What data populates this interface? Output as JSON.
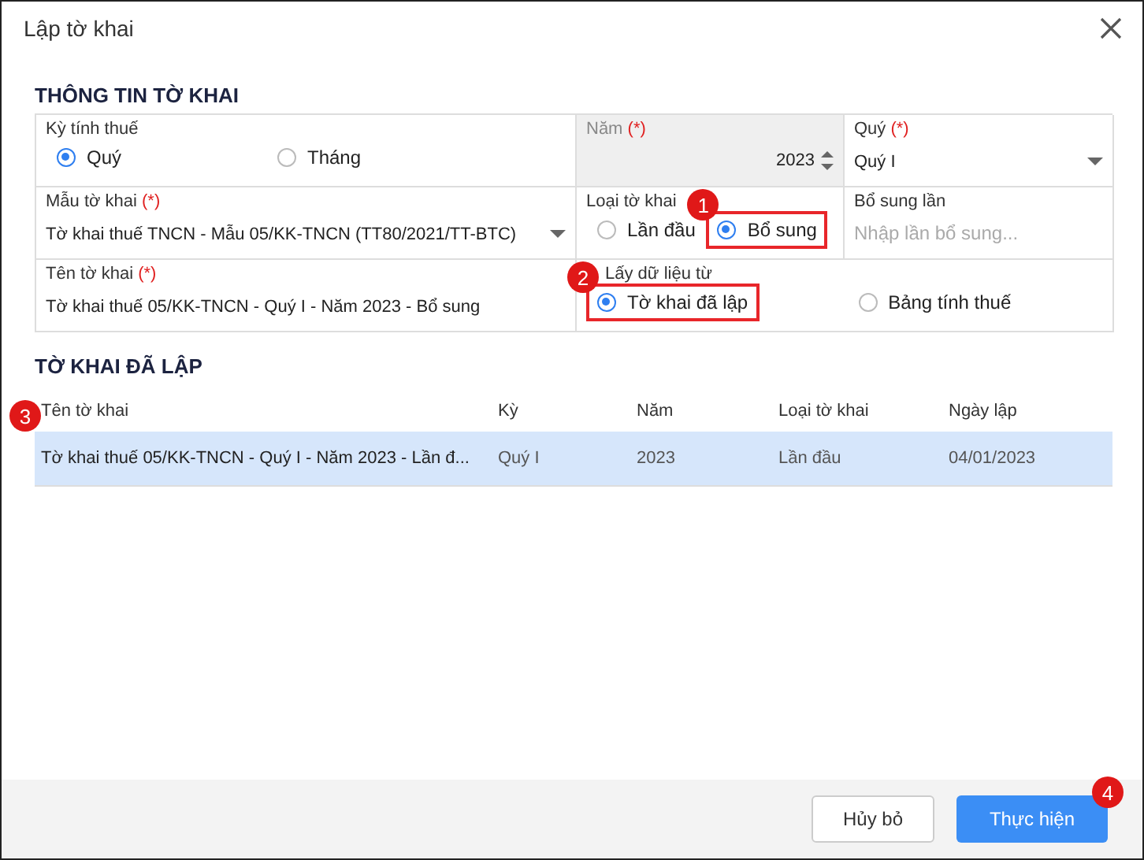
{
  "window": {
    "title": "Lập tờ khai"
  },
  "info": {
    "heading": "THÔNG TIN TỜ KHAI",
    "period": {
      "label": "Kỳ tính thuế",
      "options": [
        {
          "label": "Quý",
          "selected": true,
          "highlighted": false
        },
        {
          "label": "Tháng",
          "selected": false,
          "highlighted": false
        }
      ]
    },
    "year": {
      "label": "Năm",
      "required": "(*)",
      "value": "2023",
      "disabled": true
    },
    "quarter": {
      "label": "Quý",
      "required": "(*)",
      "value": "Quý I"
    },
    "form": {
      "label": "Mẫu tờ khai",
      "required": "(*)",
      "value": "Tờ khai thuế TNCN - Mẫu 05/KK-TNCN (TT80/2021/TT-BTC)"
    },
    "type": {
      "label": "Loại tờ khai",
      "options": [
        {
          "label": "Lần đầu",
          "selected": false,
          "highlighted": false
        },
        {
          "label": "Bổ sung",
          "selected": true,
          "highlighted": true,
          "badge": "1"
        }
      ]
    },
    "supplement": {
      "label": "Bổ sung lần",
      "placeholder": "Nhập lần bổ sung..."
    },
    "name": {
      "label": "Tên tờ khai",
      "required": "(*)",
      "value": "Tờ khai thuế 05/KK-TNCN - Quý I - Năm 2023 - Bổ sung"
    },
    "source": {
      "label": "Lấy dữ liệu từ",
      "options": [
        {
          "label": "Tờ khai đã lập",
          "selected": true,
          "highlighted": true,
          "badge": "2"
        },
        {
          "label": "Bảng tính thuế",
          "selected": false,
          "highlighted": false
        }
      ]
    }
  },
  "created": {
    "heading": "TỜ KHAI ĐÃ LẬP",
    "badge": "3",
    "columns": [
      "Tên tờ khai",
      "Kỳ",
      "Năm",
      "Loại tờ khai",
      "Ngày lập"
    ],
    "rows": [
      {
        "selected": true,
        "cells": [
          "Tờ khai thuế 05/KK-TNCN - Quý I - Năm 2023 - Lần đ...",
          "Quý I",
          "2023",
          "Lần đầu",
          "04/01/2023"
        ]
      }
    ]
  },
  "buttons": [
    {
      "label": "Hủy bỏ",
      "kind": "secondary"
    },
    {
      "label": "Thực hiện",
      "kind": "primary",
      "badge": "4"
    }
  ]
}
